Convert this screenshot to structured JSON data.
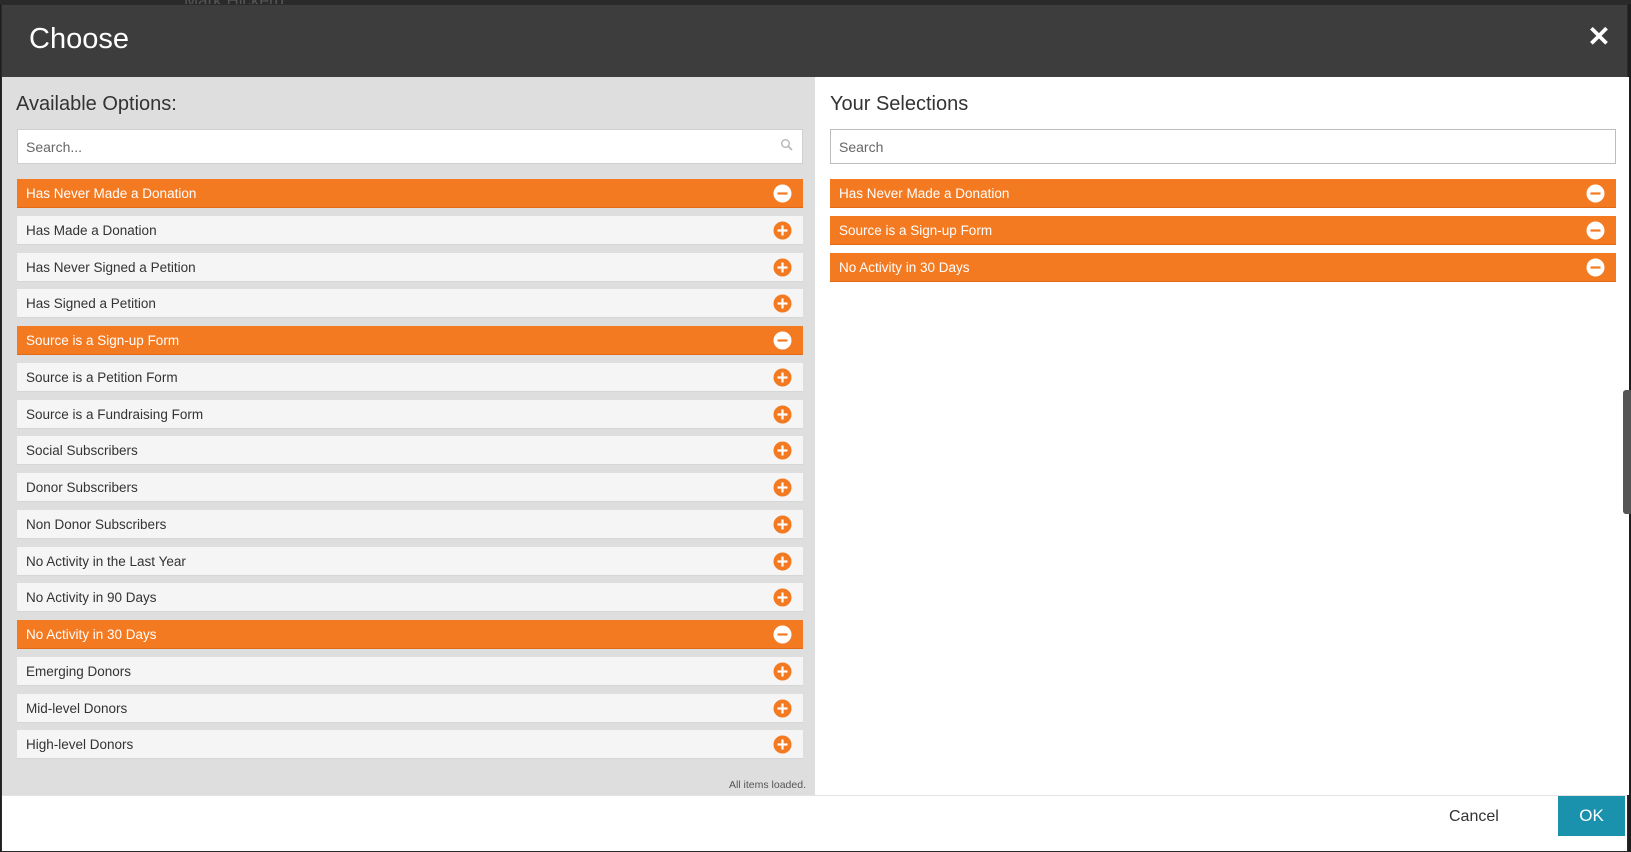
{
  "dialog": {
    "title": "Choose",
    "close_icon": "close-icon"
  },
  "available": {
    "heading": "Available Options:",
    "search_placeholder": "Search...",
    "status": "All items loaded.",
    "items": [
      {
        "label": "Has Never Made a Donation",
        "selected": true
      },
      {
        "label": "Has Made a Donation",
        "selected": false
      },
      {
        "label": "Has Never Signed a Petition",
        "selected": false
      },
      {
        "label": "Has Signed a Petition",
        "selected": false
      },
      {
        "label": "Source is a Sign-up Form",
        "selected": true
      },
      {
        "label": "Source is a Petition Form",
        "selected": false
      },
      {
        "label": "Source is a Fundraising Form",
        "selected": false
      },
      {
        "label": "Social Subscribers",
        "selected": false
      },
      {
        "label": "Donor Subscribers",
        "selected": false
      },
      {
        "label": "Non Donor Subscribers",
        "selected": false
      },
      {
        "label": "No Activity in the Last Year",
        "selected": false
      },
      {
        "label": "No Activity in 90 Days",
        "selected": false
      },
      {
        "label": "No Activity in 30 Days",
        "selected": true
      },
      {
        "label": "Emerging Donors",
        "selected": false
      },
      {
        "label": "Mid-level Donors",
        "selected": false
      },
      {
        "label": "High-level Donors",
        "selected": false
      }
    ]
  },
  "selections": {
    "heading": "Your Selections",
    "search_placeholder": "Search",
    "items": [
      {
        "label": "Has Never Made a Donation"
      },
      {
        "label": "Source is a Sign-up Form"
      },
      {
        "label": "No Activity in 30 Days"
      }
    ]
  },
  "footer": {
    "cancel_label": "Cancel",
    "ok_label": "OK"
  },
  "colors": {
    "accent": "#f47a22",
    "header": "#3d3d3d",
    "ok_button": "#1a91ad"
  }
}
